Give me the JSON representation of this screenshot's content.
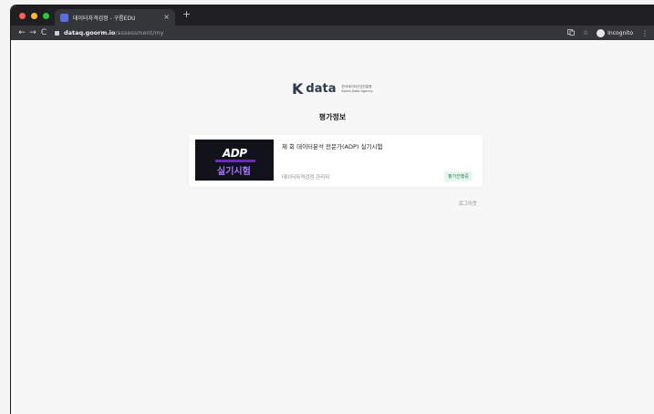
{
  "browser": {
    "tab_title": "데이터자격검정 - 구름EDU",
    "tab_close": "×",
    "new_tab": "+",
    "back": "←",
    "forward": "→",
    "reload": "C",
    "url_host": "dataq.goorm.io",
    "url_path": "/assessment/my",
    "incognito_label": "Incognito",
    "menu": "⋮",
    "traffic_colors": [
      "#ff5f57",
      "#febc2e",
      "#28c840"
    ]
  },
  "logo": {
    "mark": "K",
    "text": "data",
    "org_name_ko": "한국데이터산업진흥원",
    "org_name_en": "Korea Data Agency"
  },
  "page": {
    "title": "평가정보"
  },
  "assessment_card": {
    "thumb_main": "ADP",
    "thumb_sub": "실기시험",
    "title": "제   회 데이터분석 전문가(ADP) 실기시험",
    "subtitle": "데이터자격검정 관리자",
    "status_badge": "평가진행중",
    "status_color": "#2a7d52"
  },
  "footer": {
    "logout": "로그아웃"
  }
}
